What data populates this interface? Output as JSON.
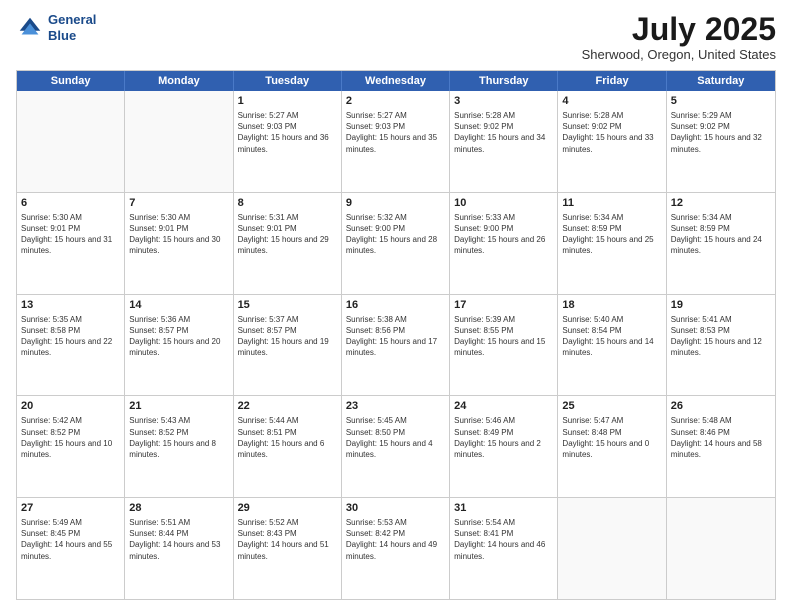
{
  "logo": {
    "line1": "General",
    "line2": "Blue"
  },
  "title": "July 2025",
  "subtitle": "Sherwood, Oregon, United States",
  "days": [
    "Sunday",
    "Monday",
    "Tuesday",
    "Wednesday",
    "Thursday",
    "Friday",
    "Saturday"
  ],
  "weeks": [
    [
      {
        "day": "",
        "info": ""
      },
      {
        "day": "",
        "info": ""
      },
      {
        "day": "1",
        "info": "Sunrise: 5:27 AM\nSunset: 9:03 PM\nDaylight: 15 hours and 36 minutes."
      },
      {
        "day": "2",
        "info": "Sunrise: 5:27 AM\nSunset: 9:03 PM\nDaylight: 15 hours and 35 minutes."
      },
      {
        "day": "3",
        "info": "Sunrise: 5:28 AM\nSunset: 9:02 PM\nDaylight: 15 hours and 34 minutes."
      },
      {
        "day": "4",
        "info": "Sunrise: 5:28 AM\nSunset: 9:02 PM\nDaylight: 15 hours and 33 minutes."
      },
      {
        "day": "5",
        "info": "Sunrise: 5:29 AM\nSunset: 9:02 PM\nDaylight: 15 hours and 32 minutes."
      }
    ],
    [
      {
        "day": "6",
        "info": "Sunrise: 5:30 AM\nSunset: 9:01 PM\nDaylight: 15 hours and 31 minutes."
      },
      {
        "day": "7",
        "info": "Sunrise: 5:30 AM\nSunset: 9:01 PM\nDaylight: 15 hours and 30 minutes."
      },
      {
        "day": "8",
        "info": "Sunrise: 5:31 AM\nSunset: 9:01 PM\nDaylight: 15 hours and 29 minutes."
      },
      {
        "day": "9",
        "info": "Sunrise: 5:32 AM\nSunset: 9:00 PM\nDaylight: 15 hours and 28 minutes."
      },
      {
        "day": "10",
        "info": "Sunrise: 5:33 AM\nSunset: 9:00 PM\nDaylight: 15 hours and 26 minutes."
      },
      {
        "day": "11",
        "info": "Sunrise: 5:34 AM\nSunset: 8:59 PM\nDaylight: 15 hours and 25 minutes."
      },
      {
        "day": "12",
        "info": "Sunrise: 5:34 AM\nSunset: 8:59 PM\nDaylight: 15 hours and 24 minutes."
      }
    ],
    [
      {
        "day": "13",
        "info": "Sunrise: 5:35 AM\nSunset: 8:58 PM\nDaylight: 15 hours and 22 minutes."
      },
      {
        "day": "14",
        "info": "Sunrise: 5:36 AM\nSunset: 8:57 PM\nDaylight: 15 hours and 20 minutes."
      },
      {
        "day": "15",
        "info": "Sunrise: 5:37 AM\nSunset: 8:57 PM\nDaylight: 15 hours and 19 minutes."
      },
      {
        "day": "16",
        "info": "Sunrise: 5:38 AM\nSunset: 8:56 PM\nDaylight: 15 hours and 17 minutes."
      },
      {
        "day": "17",
        "info": "Sunrise: 5:39 AM\nSunset: 8:55 PM\nDaylight: 15 hours and 15 minutes."
      },
      {
        "day": "18",
        "info": "Sunrise: 5:40 AM\nSunset: 8:54 PM\nDaylight: 15 hours and 14 minutes."
      },
      {
        "day": "19",
        "info": "Sunrise: 5:41 AM\nSunset: 8:53 PM\nDaylight: 15 hours and 12 minutes."
      }
    ],
    [
      {
        "day": "20",
        "info": "Sunrise: 5:42 AM\nSunset: 8:52 PM\nDaylight: 15 hours and 10 minutes."
      },
      {
        "day": "21",
        "info": "Sunrise: 5:43 AM\nSunset: 8:52 PM\nDaylight: 15 hours and 8 minutes."
      },
      {
        "day": "22",
        "info": "Sunrise: 5:44 AM\nSunset: 8:51 PM\nDaylight: 15 hours and 6 minutes."
      },
      {
        "day": "23",
        "info": "Sunrise: 5:45 AM\nSunset: 8:50 PM\nDaylight: 15 hours and 4 minutes."
      },
      {
        "day": "24",
        "info": "Sunrise: 5:46 AM\nSunset: 8:49 PM\nDaylight: 15 hours and 2 minutes."
      },
      {
        "day": "25",
        "info": "Sunrise: 5:47 AM\nSunset: 8:48 PM\nDaylight: 15 hours and 0 minutes."
      },
      {
        "day": "26",
        "info": "Sunrise: 5:48 AM\nSunset: 8:46 PM\nDaylight: 14 hours and 58 minutes."
      }
    ],
    [
      {
        "day": "27",
        "info": "Sunrise: 5:49 AM\nSunset: 8:45 PM\nDaylight: 14 hours and 55 minutes."
      },
      {
        "day": "28",
        "info": "Sunrise: 5:51 AM\nSunset: 8:44 PM\nDaylight: 14 hours and 53 minutes."
      },
      {
        "day": "29",
        "info": "Sunrise: 5:52 AM\nSunset: 8:43 PM\nDaylight: 14 hours and 51 minutes."
      },
      {
        "day": "30",
        "info": "Sunrise: 5:53 AM\nSunset: 8:42 PM\nDaylight: 14 hours and 49 minutes."
      },
      {
        "day": "31",
        "info": "Sunrise: 5:54 AM\nSunset: 8:41 PM\nDaylight: 14 hours and 46 minutes."
      },
      {
        "day": "",
        "info": ""
      },
      {
        "day": "",
        "info": ""
      }
    ]
  ]
}
